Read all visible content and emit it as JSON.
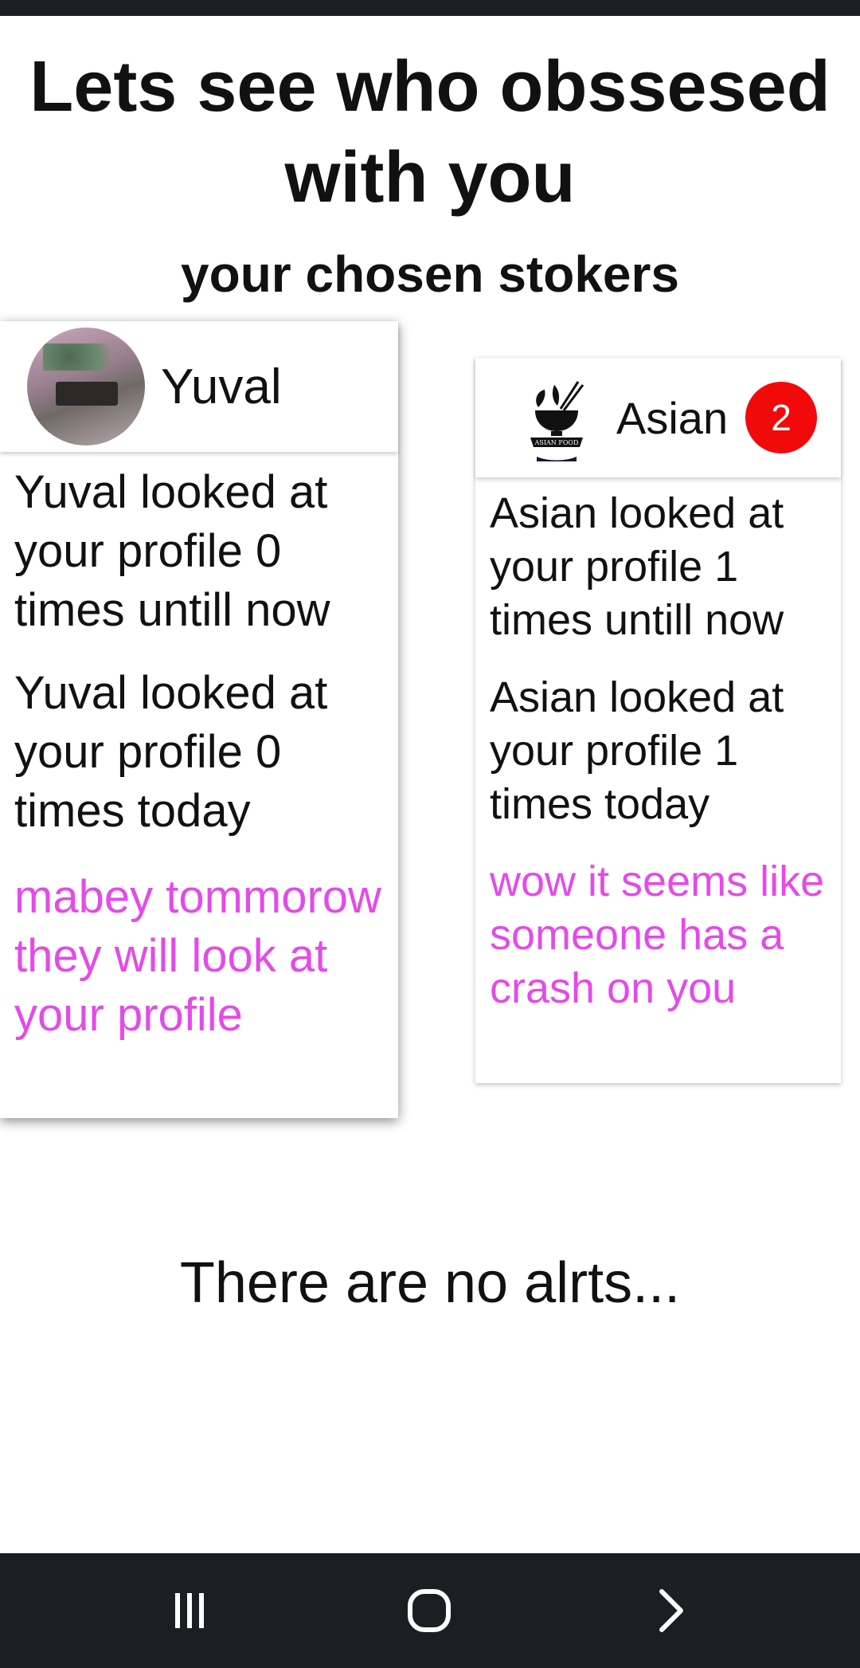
{
  "header": {
    "title": "Lets see who obssesed with you",
    "subtitle": "your chosen stokers"
  },
  "cards": [
    {
      "name": "Yuval",
      "avatar_icon": "profile-photo",
      "line_total": "Yuval looked at your profile 0 times untill now",
      "line_today": "Yuval looked at your profile 0 times today",
      "message": "mabey tommorow they will look at your profile"
    },
    {
      "name": "Asian",
      "avatar_icon": "asian-food-logo",
      "logo_text": "ASIAN FOOD",
      "badge": "2",
      "line_total": "Asian looked at your profile 1 times untill now",
      "line_today": "Asian looked at your profile 1 times today",
      "message": "wow it seems like someone has a crash on you"
    }
  ],
  "alerts": {
    "empty_text": "There are no alrts..."
  },
  "navigation": {
    "recents_icon": "recents-icon",
    "home_icon": "home-icon",
    "back_icon": "back-icon"
  },
  "colors": {
    "accent_pink": "#e34be8",
    "badge_red": "#f20a0a",
    "system_bar": "#1b1e23"
  }
}
